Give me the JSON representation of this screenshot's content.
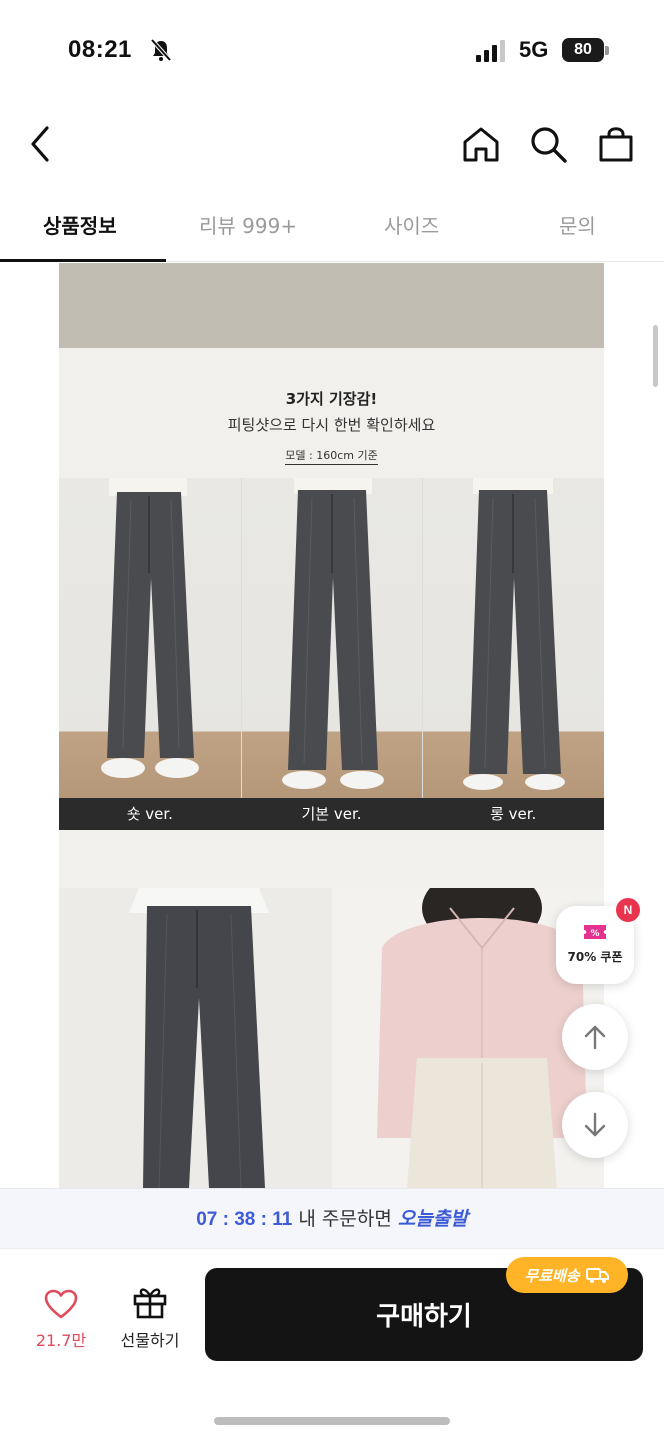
{
  "status_bar": {
    "time": "08:21",
    "network": "5G",
    "battery": "80"
  },
  "nav": {
    "back_icon": "chevron-left-icon",
    "home_icon": "home-icon",
    "search_icon": "search-icon",
    "cart_icon": "shopping-bag-icon"
  },
  "tabs": [
    {
      "label": "상품정보",
      "active": true
    },
    {
      "label": "리뷰 999+",
      "active": false
    },
    {
      "label": "사이즈",
      "active": false
    },
    {
      "label": "문의",
      "active": false
    }
  ],
  "content": {
    "heading": "3가지 기장감!",
    "subheading": "피팅샷으로 다시 한번 확인하세요",
    "model_note": "모델 : 160cm 기준",
    "captions": [
      "숏 ver.",
      "기본 ver.",
      "롱 ver."
    ]
  },
  "floating": {
    "coupon_label": "70% 쿠폰",
    "new_badge": "N"
  },
  "timer": {
    "countdown": "07 : 38 : 11",
    "text": "내 주문하면",
    "emphasis": "오늘출발"
  },
  "bottom": {
    "like_count": "21.7만",
    "gift_label": "선물하기",
    "buy_label": "구매하기",
    "free_shipping": "무료배송"
  },
  "colors": {
    "accent_blue": "#3d5bd6",
    "heart_red": "#e04a5a",
    "badge_orange": "#ffb428",
    "buy_button": "#141414"
  }
}
